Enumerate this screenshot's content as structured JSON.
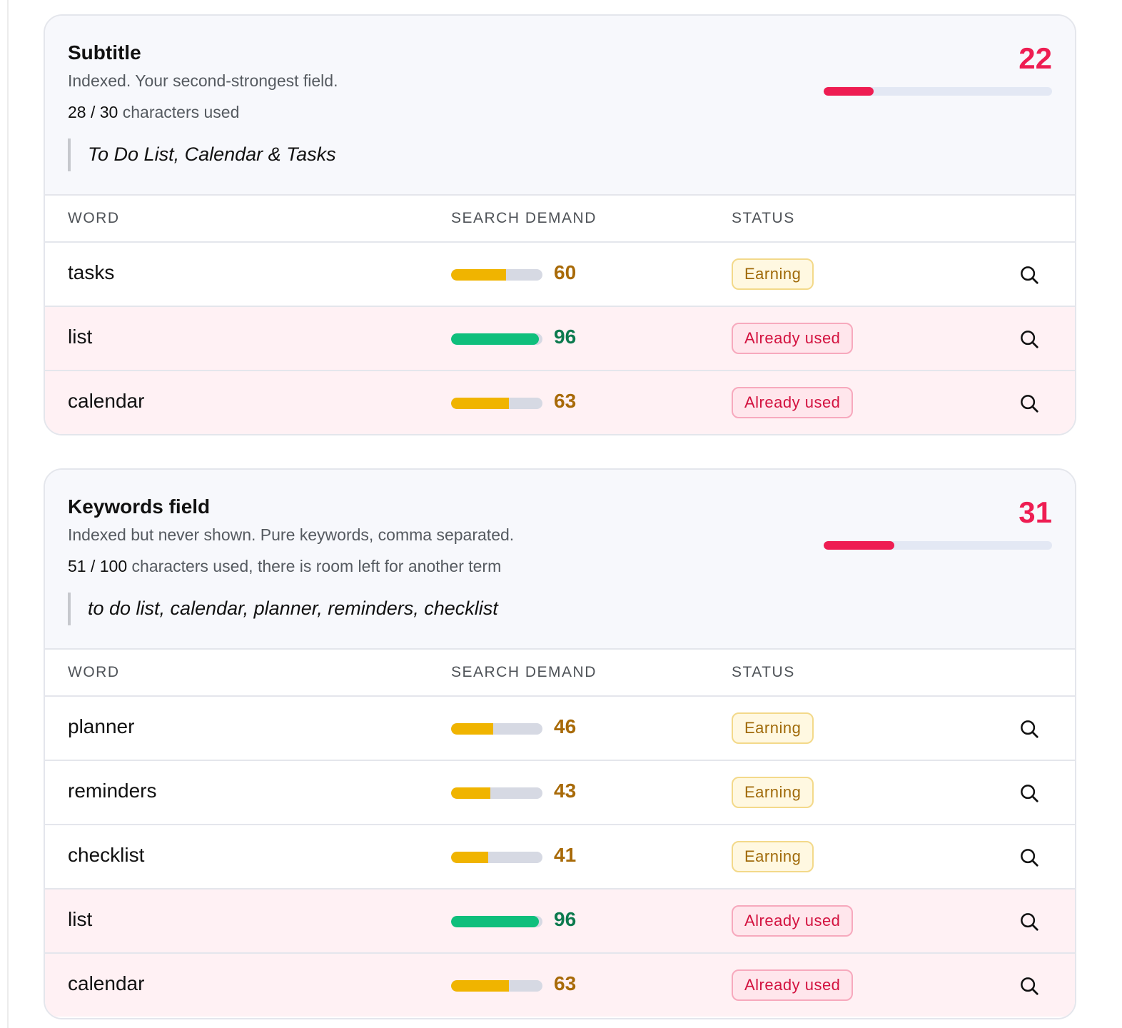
{
  "cards": [
    {
      "title": "Subtitle",
      "description": "Indexed. Your second-strongest field.",
      "chars_used": "28",
      "chars_separator": " / ",
      "chars_max": "30",
      "chars_suffix": " characters used",
      "content": "To Do List, Calendar & Tasks",
      "score": "22",
      "score_fraction": 0.22,
      "columns": {
        "word": "WORD",
        "demand": "SEARCH DEMAND",
        "status": "STATUS"
      },
      "rows": [
        {
          "word": "tasks",
          "demand": "60",
          "demand_fraction": 0.6,
          "demand_color": "amber",
          "status": "Earning",
          "status_type": "earning",
          "icon": "search-icon"
        },
        {
          "word": "list",
          "demand": "96",
          "demand_fraction": 0.96,
          "demand_color": "green",
          "status": "Already used",
          "status_type": "used",
          "icon": "search-icon"
        },
        {
          "word": "calendar",
          "demand": "63",
          "demand_fraction": 0.63,
          "demand_color": "amber",
          "status": "Already used",
          "status_type": "used",
          "icon": "search-icon"
        }
      ]
    },
    {
      "title": "Keywords field",
      "description": "Indexed but never shown. Pure keywords, comma separated.",
      "chars_used": "51",
      "chars_separator": " / ",
      "chars_max": "100",
      "chars_suffix": " characters used, there is room left for another term",
      "content": "to do list, calendar, planner, reminders, checklist",
      "score": "31",
      "score_fraction": 0.31,
      "columns": {
        "word": "WORD",
        "demand": "SEARCH DEMAND",
        "status": "STATUS"
      },
      "rows": [
        {
          "word": "planner",
          "demand": "46",
          "demand_fraction": 0.46,
          "demand_color": "amber",
          "status": "Earning",
          "status_type": "earning",
          "icon": "search-icon"
        },
        {
          "word": "reminders",
          "demand": "43",
          "demand_fraction": 0.43,
          "demand_color": "amber",
          "status": "Earning",
          "status_type": "earning",
          "icon": "search-icon"
        },
        {
          "word": "checklist",
          "demand": "41",
          "demand_fraction": 0.41,
          "demand_color": "amber",
          "status": "Earning",
          "status_type": "earning",
          "icon": "search-icon"
        },
        {
          "word": "list",
          "demand": "96",
          "demand_fraction": 0.96,
          "demand_color": "green",
          "status": "Already used",
          "status_type": "used",
          "icon": "search-icon"
        },
        {
          "word": "calendar",
          "demand": "63",
          "demand_fraction": 0.63,
          "demand_color": "amber",
          "status": "Already used",
          "status_type": "used",
          "icon": "search-icon"
        }
      ]
    }
  ],
  "colors": {
    "score": "#ee1d52",
    "amber": "#f0b400",
    "green": "#0fbf7c",
    "used_row": "#fff1f4"
  }
}
